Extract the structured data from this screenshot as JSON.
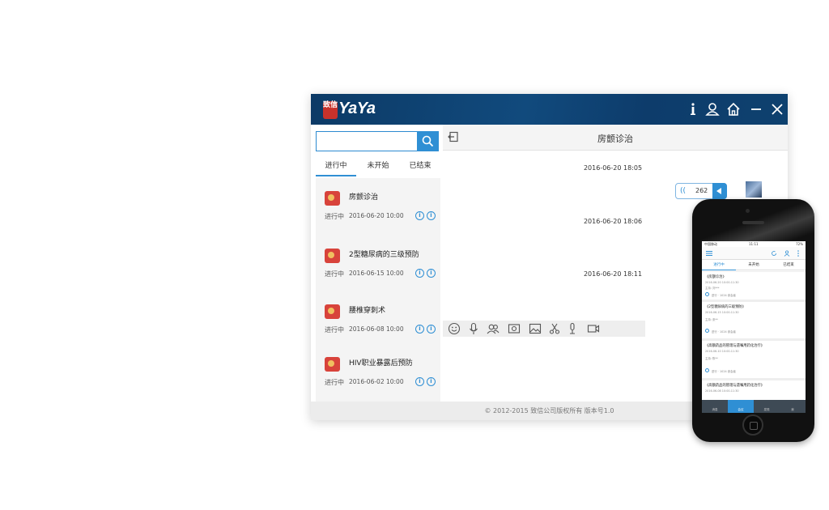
{
  "app": {
    "logo_seal": "致信",
    "logo_text": "YaYa"
  },
  "window_controls": [
    "info-icon",
    "user-icon",
    "home-icon",
    "minimize-icon",
    "close-icon"
  ],
  "search": {
    "placeholder": ""
  },
  "tabs": [
    {
      "label": "进行中",
      "active": true
    },
    {
      "label": "未开始"
    },
    {
      "label": "已结束"
    }
  ],
  "consultations": [
    {
      "title": "房颤诊治",
      "status": "进行中",
      "date": "2016-06-20 10:00"
    },
    {
      "title": "2型糖尿病的三级预防",
      "status": "进行中",
      "date": "2016-06-15 10:00"
    },
    {
      "title": "腰椎穿刺术",
      "status": "进行中",
      "date": "2016-06-08 10:00"
    },
    {
      "title": "HIV职业暴露后预防",
      "status": "进行中",
      "date": "2016-06-02 10:00"
    }
  ],
  "chat": {
    "title": "房颤诊治",
    "messages": [
      {
        "timestamp": "2016-06-20 18:05",
        "voice_count": "262"
      },
      {
        "timestamp": "2016-06-20 18:06"
      },
      {
        "timestamp": "2016-06-20 18:11"
      }
    ]
  },
  "toolbar_icons": [
    "emoji-icon",
    "microphone-icon",
    "group-icon",
    "photo-album-icon",
    "image-icon",
    "scissors-icon",
    "audio-icon",
    "video-icon"
  ],
  "footer": {
    "text": "© 2012-2015 致信公司版权所有 版本号1.0"
  },
  "phone": {
    "status_left": "中国移动",
    "status_time": "11:11",
    "status_right": "72%",
    "tabs": [
      {
        "label": "进行中",
        "active": true
      },
      {
        "label": "未开始"
      },
      {
        "label": "已结束"
      }
    ],
    "cards": [
      {
        "title": "《房颤诊治》",
        "line1": "2016-06-20 10:00-11:30",
        "line2": "主持: 刘***",
        "footer": "进行 · 1024 参会者"
      },
      {
        "title": "《2型糖尿病的三级预防》",
        "line1": "2016-06-15 10:00-11:30",
        "line2": "主持: 张**",
        "footer": "进行 · 1024 参会者"
      },
      {
        "title": "《高额药品的管理与遗嘱用药化治疗》",
        "line1": "2016-06-10 10:00-11:30",
        "line2": "主持: 陈**",
        "footer": "进行 · 1024 参会者"
      },
      {
        "title": "《高额药品的管理与遗嘱用药化治疗》",
        "line1": "2016-06-08 10:00-11:30",
        "line2": "",
        "footer": ""
      }
    ],
    "bottom_nav": [
      {
        "label": "消息"
      },
      {
        "label": "会议",
        "active": true
      },
      {
        "label": "发现"
      },
      {
        "label": "我"
      }
    ]
  }
}
